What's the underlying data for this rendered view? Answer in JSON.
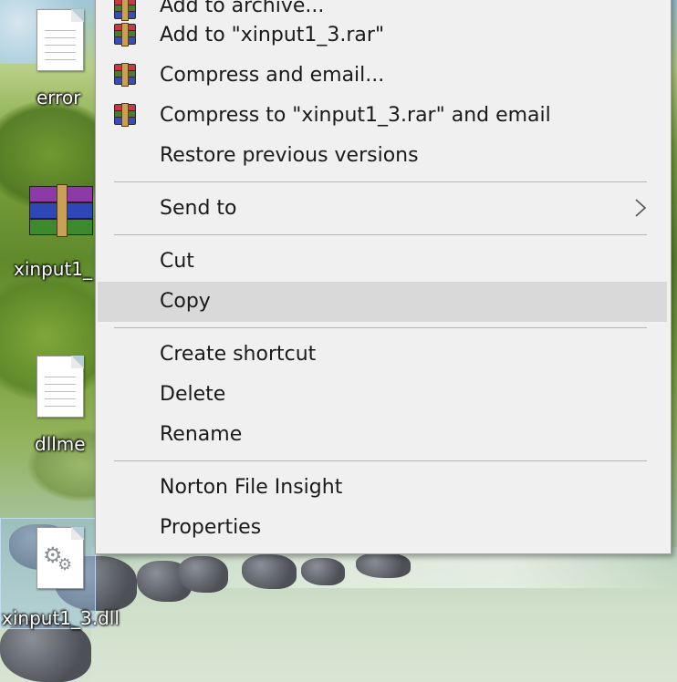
{
  "desktop": {
    "icons": [
      {
        "label": "error",
        "icon": "text-document-icon"
      },
      {
        "label": "xinput1_",
        "icon": "winrar-archive-icon"
      },
      {
        "label": "dllme",
        "icon": "text-document-icon"
      },
      {
        "label": "xinput1_3.dll",
        "icon": "dll-gear-file-icon"
      }
    ]
  },
  "context_menu": {
    "items": [
      {
        "label": "Add to archive...",
        "icon": "winrar-icon"
      },
      {
        "label": "Add to \"xinput1_3.rar\"",
        "icon": "winrar-icon"
      },
      {
        "label": "Compress and email...",
        "icon": "winrar-icon"
      },
      {
        "label": "Compress to \"xinput1_3.rar\" and email",
        "icon": "winrar-icon"
      },
      {
        "label": "Restore previous versions"
      },
      {
        "label": "Send to",
        "icon": "chevron-right-icon"
      },
      {
        "label": "Cut"
      },
      {
        "label": "Copy",
        "highlighted": true
      },
      {
        "label": "Create shortcut"
      },
      {
        "label": "Delete"
      },
      {
        "label": "Rename"
      },
      {
        "label": "Norton File Insight"
      },
      {
        "label": "Properties"
      }
    ]
  },
  "colors": {
    "menu_background": "#f0f0f0",
    "menu_highlight": "#d9d9d9",
    "separator": "#b5b5b5"
  }
}
